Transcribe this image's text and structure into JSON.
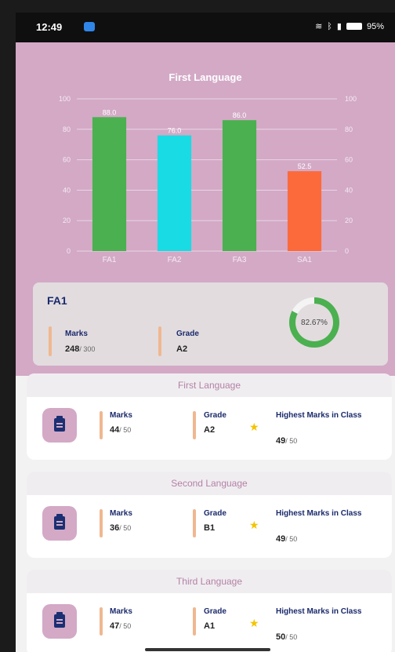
{
  "status_bar": {
    "time": "12:49",
    "battery": "95%",
    "icons": [
      "notification-icon",
      "wifi-icon",
      "bluetooth-icon",
      "signal-icon",
      "battery-icon"
    ]
  },
  "chart_data": {
    "type": "bar",
    "title": "First Language",
    "categories": [
      "FA1",
      "FA2",
      "FA3",
      "SA1"
    ],
    "values": [
      88.0,
      76.0,
      86.0,
      52.5
    ],
    "value_labels": [
      "88.0",
      "76.0",
      "86.0",
      "52.5"
    ],
    "colors": [
      "#4bb04f",
      "#19dbe3",
      "#4bb04f",
      "#fc6a3c"
    ],
    "ylim": [
      0,
      100
    ],
    "yticks": [
      0,
      20,
      40,
      60,
      80,
      100
    ],
    "right_axis_ticks": [
      0,
      20,
      40,
      60,
      80,
      100
    ],
    "grid": true
  },
  "summary": {
    "title": "FA1",
    "marks_label": "Marks",
    "marks_value": "248",
    "marks_total": "/ 300",
    "grade_label": "Grade",
    "grade_value": "A2",
    "percent_text": "82.67%",
    "percent": 82.67,
    "ring_color": "#4bb04f"
  },
  "subjects": [
    {
      "name": "First Language",
      "marks_label": "Marks",
      "marks": "44",
      "marks_total": "/ 50",
      "grade_label": "Grade",
      "grade": "A2",
      "highest_label": "Highest Marks in Class",
      "highest": "49",
      "highest_total": "/ 50"
    },
    {
      "name": "Second Language",
      "marks_label": "Marks",
      "marks": "36",
      "marks_total": "/ 50",
      "grade_label": "Grade",
      "grade": "B1",
      "highest_label": "Highest Marks in Class",
      "highest": "49",
      "highest_total": "/ 50"
    },
    {
      "name": "Third Language",
      "marks_label": "Marks",
      "marks": "47",
      "marks_total": "/ 50",
      "grade_label": "Grade",
      "grade": "A1",
      "highest_label": "Highest Marks in Class",
      "highest": "50",
      "highest_total": "/ 50"
    }
  ]
}
